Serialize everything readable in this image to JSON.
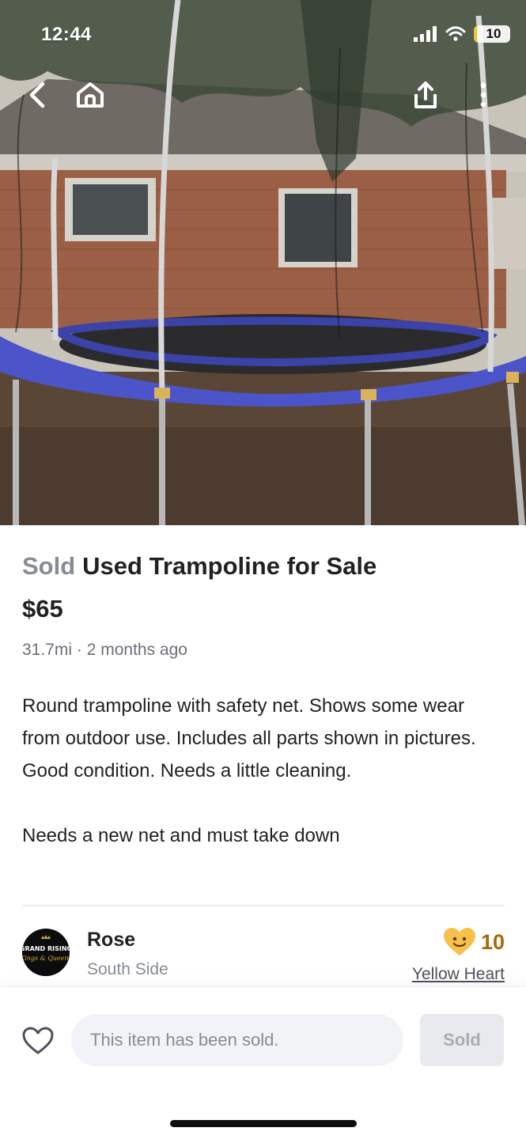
{
  "status_bar": {
    "time": "12:44",
    "battery_level": "10"
  },
  "nav": {
    "back_icon": "chevron-left-icon",
    "home_icon": "home-icon",
    "share_icon": "share-icon"
  },
  "listing": {
    "status": "Sold",
    "title": "Used Trampoline for Sale",
    "price": "$65",
    "distance": "31.7mi",
    "separator": "·",
    "posted": "2 months ago",
    "description": "Round trampoline with safety net.  Shows some wear from outdoor use.  Includes all parts shown in pictures.  Good condition. Needs a little cleaning.\n\nNeeds a new net and must take down"
  },
  "seller": {
    "name": "Rose",
    "neighborhood": "South Side",
    "manner_score": "10",
    "manner_label": "Yellow Heart",
    "manner_icon": "smiling-yellow-heart-icon",
    "avatar_text_top": "GRAND RISING",
    "avatar_text_script": "Kings & Queens"
  },
  "bottom_bar": {
    "like_icon": "heart-outline-icon",
    "message": "This item has been sold.",
    "button_label": "Sold"
  },
  "colors": {
    "sold_gray": "#868b94",
    "text": "#212124",
    "badge_gold": "#a8690c",
    "trampoline_pad": "#4b55c9"
  }
}
